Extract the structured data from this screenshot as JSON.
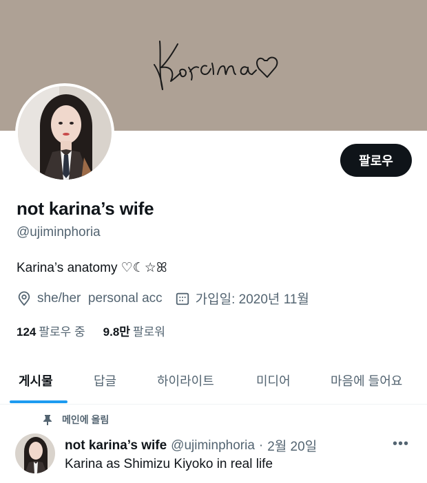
{
  "profile": {
    "banner_color": "#aea195",
    "banner_signature": "Karina",
    "follow_button": "팔로우",
    "display_name": "not karina’s wife",
    "handle": "@ujiminphoria",
    "bio": "Karina’s anatomy ♡☾☆ꕤ",
    "location_icon": "location-pin-icon",
    "location_text": "she/her  personal acc",
    "joined_icon": "calendar-icon",
    "joined_text": "가입일: 2020년 11월",
    "following_count": "124",
    "following_label": "팔로우 중",
    "followers_count": "9.8만",
    "followers_label": "팔로워"
  },
  "tabs": [
    {
      "label": "게시물",
      "active": true
    },
    {
      "label": "답글"
    },
    {
      "label": "하이라이트"
    },
    {
      "label": "미디어"
    },
    {
      "label": "마음에 들어요"
    }
  ],
  "accent_color": "#1d9bf0",
  "pinned_post": {
    "pin_icon": "pin-icon",
    "pinned_label": "메인에 올림",
    "author_name": "not karina’s wife",
    "author_handle": "@ujiminphoria",
    "separator": "·",
    "date": "2월 20일",
    "more_icon": "more-options-icon",
    "text": "Karina as Shimizu Kiyoko in real life"
  }
}
